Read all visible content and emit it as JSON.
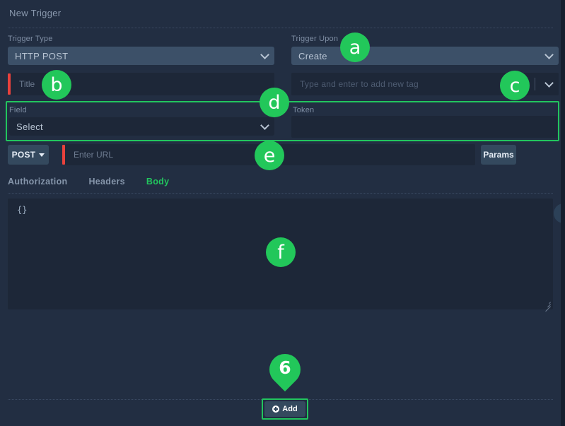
{
  "window": {
    "title": "New Trigger"
  },
  "colors": {
    "accent_green": "#22c55e",
    "marker_green": "#22c75a",
    "required_red": "#e8413c",
    "panel_bg": "#222e42",
    "input_bg": "#1d2738",
    "select_bg": "#3c5068",
    "button_bg": "#34495e"
  },
  "form": {
    "trigger_type": {
      "label": "Trigger Type",
      "value": "HTTP POST",
      "chevron_icon": "chevron-down-icon"
    },
    "trigger_upon": {
      "label": "Trigger Upon",
      "value": "Create",
      "chevron_icon": "chevron-down-icon"
    },
    "title": {
      "placeholder": "Title",
      "value": "",
      "required": true
    },
    "tags": {
      "placeholder": "Type and enter to add new tag",
      "value": "",
      "chevron_icon": "chevron-down-icon"
    },
    "field": {
      "label": "Field",
      "value": "Select",
      "chevron_icon": "chevron-down-icon"
    },
    "token": {
      "label": "Token",
      "value": "",
      "placeholder": ""
    },
    "method": {
      "label": "POST",
      "caret_icon": "caret-down-icon"
    },
    "url": {
      "placeholder": "Enter URL",
      "value": "",
      "required": true
    },
    "params_button": {
      "label": "Params"
    }
  },
  "tabs": [
    {
      "label": "Authorization",
      "active": false
    },
    {
      "label": "Headers",
      "active": false
    },
    {
      "label": "Body",
      "active": true
    }
  ],
  "body_editor": {
    "content": "{}",
    "resize_handle": "resize-grip-icon"
  },
  "close_button": {
    "label": "×",
    "icon": "close-icon"
  },
  "footer": {
    "add_button": {
      "label": "Add",
      "icon": "plus-circle-icon"
    }
  },
  "annotations": {
    "markers": [
      {
        "id": "a",
        "label": "a",
        "target": "trigger-upon-select"
      },
      {
        "id": "b",
        "label": "b",
        "target": "title-input"
      },
      {
        "id": "c",
        "label": "c",
        "target": "tags-input"
      },
      {
        "id": "d",
        "label": "d",
        "target": "field-token-group"
      },
      {
        "id": "e",
        "label": "e",
        "target": "url-input"
      },
      {
        "id": "f",
        "label": "f",
        "target": "body-textarea"
      }
    ],
    "pin": {
      "label": "6",
      "target": "add-button"
    }
  }
}
